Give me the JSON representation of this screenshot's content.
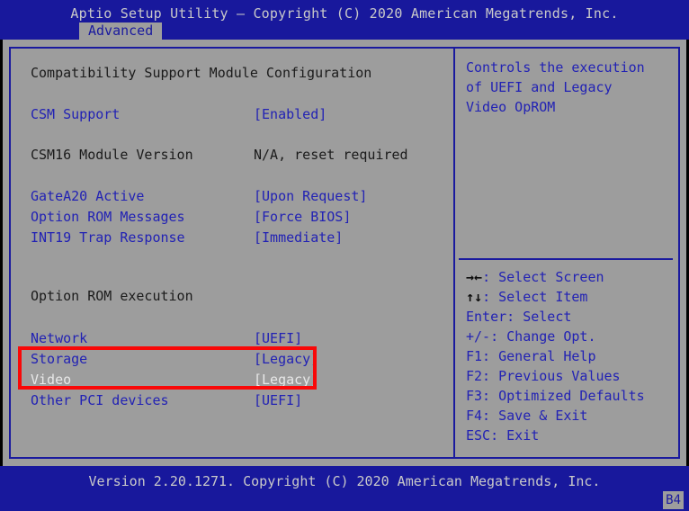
{
  "header": {
    "title": "Aptio Setup Utility – Copyright (C) 2020 American Megatrends, Inc.",
    "active_tab": "Advanced",
    "tabs": [
      "Advanced"
    ]
  },
  "colors": {
    "background_blue": "#18189c",
    "panel_gray": "#9d9d9d",
    "text_blue": "#2222b4",
    "text_dark": "#1b1b1b",
    "text_selected": "#e8e8e8",
    "frame_blue": "#1a1a9e",
    "annotation_red": "#f90808"
  },
  "main": {
    "section_title": "Compatibility Support Module Configuration",
    "group_heading": "Option ROM execution",
    "rows": [
      {
        "label": "CSM Support",
        "value": "[Enabled]",
        "style": "blue",
        "selected": false
      },
      {
        "label": "CSM16 Module Version",
        "value": "N/A, reset required",
        "style": "dark",
        "selected": false
      },
      {
        "label": "GateA20 Active",
        "value": "[Upon Request]",
        "style": "blue",
        "selected": false
      },
      {
        "label": "Option ROM Messages",
        "value": "[Force BIOS]",
        "style": "blue",
        "selected": false
      },
      {
        "label": "INT19 Trap Response",
        "value": "[Immediate]",
        "style": "blue",
        "selected": false
      },
      {
        "label": "Network",
        "value": "[UEFI]",
        "style": "blue",
        "selected": false
      },
      {
        "label": "Storage",
        "value": "[Legacy]",
        "style": "blue",
        "selected": false
      },
      {
        "label": "Video",
        "value": "[Legacy]",
        "style": "white",
        "selected": true
      },
      {
        "label": "Other PCI devices",
        "value": "[UEFI]",
        "style": "blue",
        "selected": false
      }
    ],
    "annotation": {
      "name": "red-highlight-box",
      "covers": [
        "Storage",
        "Video"
      ]
    }
  },
  "help": {
    "text": "Controls the execution\nof UEFI and Legacy\nVideo OpROM",
    "keys": [
      {
        "glyph": "→←",
        "label": ": Select Screen"
      },
      {
        "glyph": "↑↓",
        "label": ": Select Item"
      },
      {
        "glyph": "",
        "label": "Enter: Select"
      },
      {
        "glyph": "",
        "label": "+/-: Change Opt."
      },
      {
        "glyph": "",
        "label": "F1: General Help"
      },
      {
        "glyph": "",
        "label": "F2: Previous Values"
      },
      {
        "glyph": "",
        "label": "F3: Optimized Defaults"
      },
      {
        "glyph": "",
        "label": "F4: Save & Exit"
      },
      {
        "glyph": "",
        "label": "ESC: Exit"
      }
    ]
  },
  "footer": {
    "version_text": "Version 2.20.1271. Copyright (C) 2020 American Megatrends, Inc.",
    "corner_badge": "B4"
  }
}
